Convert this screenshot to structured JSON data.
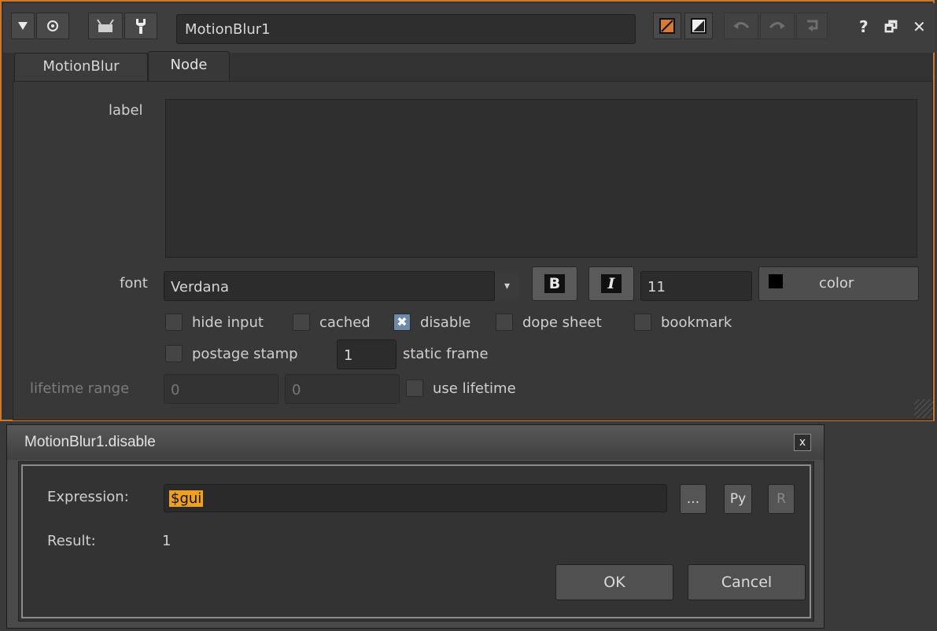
{
  "panel": {
    "node_name": "MotionBlur1",
    "tabs": [
      {
        "label": "MotionBlur"
      },
      {
        "label": "Node"
      }
    ],
    "label_field_label": "label",
    "font": {
      "label": "font",
      "value": "Verdana",
      "bold_label": "B",
      "italic_label": "I",
      "size": "11",
      "color_label": "color"
    },
    "checks": {
      "hide_input": "hide input",
      "cached": "cached",
      "disable": "disable",
      "dope_sheet": "dope sheet",
      "bookmark": "bookmark",
      "postage_stamp": "postage stamp",
      "static_frame": "static frame",
      "use_lifetime": "use lifetime"
    },
    "postage_frame_value": "1",
    "lifetime": {
      "label": "lifetime range",
      "start": "0",
      "end": "0"
    },
    "controls": {
      "help": "?",
      "float": "🗗",
      "close": "✕"
    }
  },
  "dialog": {
    "title": "MotionBlur1.disable",
    "close": "x",
    "expression_label": "Expression:",
    "expression_value": "$gui",
    "result_label": "Result:",
    "result_value": "1",
    "ellipsis_button": "...",
    "py_button": "Py",
    "r_button": "R",
    "ok_button": "OK",
    "cancel_button": "Cancel"
  },
  "colors": {
    "panel_border": "#c8782f",
    "selection": "#f0a020"
  }
}
